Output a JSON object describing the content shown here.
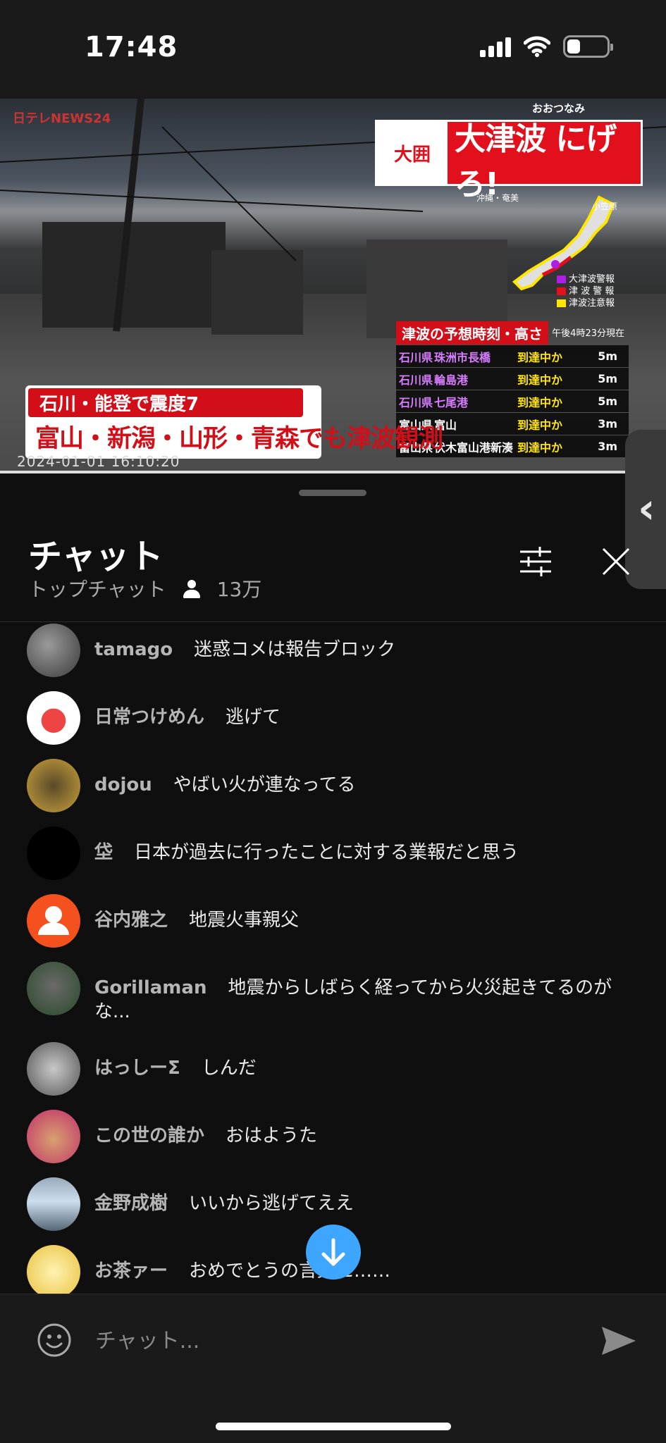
{
  "status_bar": {
    "time": "17:48"
  },
  "video": {
    "channel_logo": "日テレNEWS24",
    "banner_tag": "大囲",
    "banner_ruby": "おおつなみ",
    "banner_text": "大津波 にげろ!",
    "map_labels": {
      "okinawa": "沖縄・奄美",
      "ogasawara": "小笠原"
    },
    "legend": [
      {
        "mark": "紫",
        "label": "大津波警報",
        "color": "#b01ee6"
      },
      {
        "mark": "赤",
        "label": "津 波 警 報",
        "color": "#e1101c"
      },
      {
        "mark": "黄",
        "label": "津波注意報",
        "color": "#ffe600"
      }
    ],
    "forecast_title": "津波の予想時刻・高さ",
    "forecast_time": "午後4時23分現在",
    "forecast_rows": [
      {
        "pref": "石川県",
        "place": "珠洲市長橋",
        "status": "到達中か",
        "height": "5m",
        "major": true
      },
      {
        "pref": "石川県",
        "place": "輪島港",
        "status": "到達中か",
        "height": "5m",
        "major": true
      },
      {
        "pref": "石川県",
        "place": "七尾港",
        "status": "到達中か",
        "height": "5m",
        "major": true
      },
      {
        "pref": "富山県",
        "place": "富山",
        "status": "到達中か",
        "height": "3m",
        "major": false
      },
      {
        "pref": "富山県",
        "place": "伏木富山港新湊",
        "status": "到達中か",
        "height": "3m",
        "major": false
      }
    ],
    "caption_top": "石川・能登で震度7",
    "caption_bottom": "富山・新潟・山形・青森でも津波観測",
    "timestamp": "2024-01-01 16:10:20"
  },
  "chat": {
    "title": "チャット",
    "mode": "トップチャット",
    "viewers": "13万",
    "messages": [
      {
        "author": "tamago",
        "text": "迷惑コメは報告ブロック",
        "avatar": "photo-gray"
      },
      {
        "author": "日常つけめん",
        "text": "逃げて",
        "avatar": "ramen"
      },
      {
        "author": "dojou",
        "text": "やばい火が連なってる",
        "avatar": "gold"
      },
      {
        "author": "垈",
        "text": "日本が過去に行ったことに対する業報だと思う",
        "avatar": "black"
      },
      {
        "author": "谷内雅之",
        "text": "地震火事親父",
        "avatar": "default-orange"
      },
      {
        "author": "Gorillaman",
        "text": "地震からしばらく経ってから火災起きてるのがな...",
        "avatar": "gorilla"
      },
      {
        "author": "はっしーΣ",
        "text": "しんだ",
        "avatar": "anime-gray"
      },
      {
        "author": "この世の誰か",
        "text": "おはようた",
        "avatar": "face-red"
      },
      {
        "author": "金野成樹",
        "text": "いいから逃げてええ",
        "avatar": "landscape"
      },
      {
        "author": "お茶ァー",
        "text": "おめでとうの言葉に……",
        "avatar": "anime-yellow"
      }
    ],
    "input_placeholder": "チャット..."
  },
  "colors": {
    "accent": "#3ea6ff",
    "alert_red": "#e1101c",
    "warning_yellow": "#ffe600"
  }
}
